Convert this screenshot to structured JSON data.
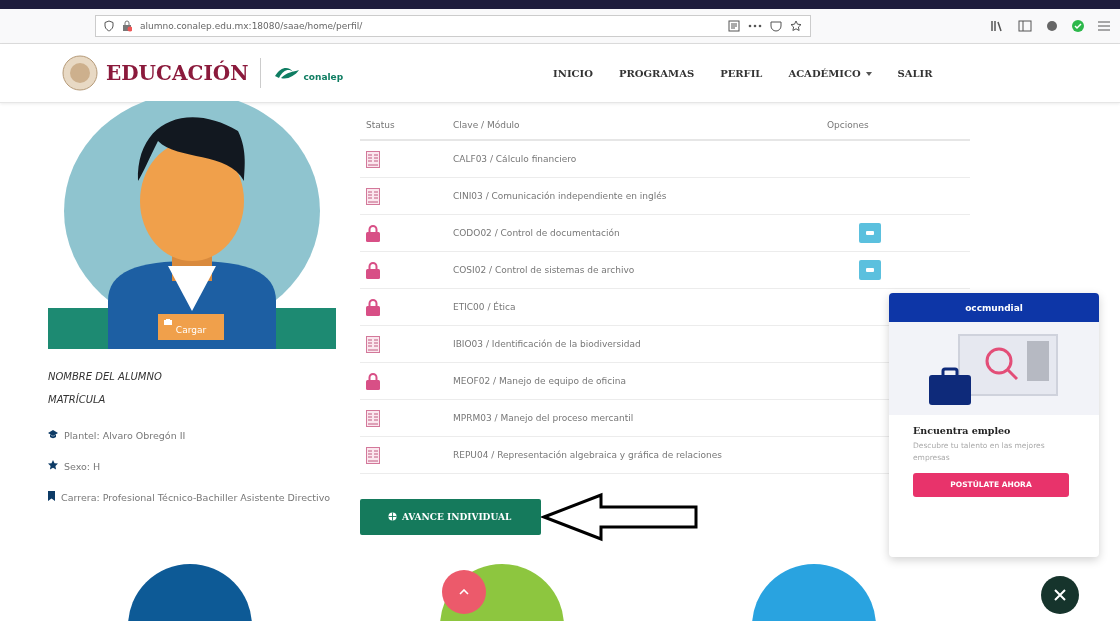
{
  "browser": {
    "url": "alumno.conalep.edu.mx:18080/saae/home/perfil/"
  },
  "header": {
    "brand": "EDUCACIÓN",
    "partner": "conalep",
    "nav": [
      {
        "label": "INICIO",
        "dropdown": false
      },
      {
        "label": "PROGRAMAS",
        "dropdown": false
      },
      {
        "label": "PERFIL",
        "dropdown": false
      },
      {
        "label": "ACADÉMICO",
        "dropdown": true
      },
      {
        "label": "SALIR",
        "dropdown": false
      }
    ]
  },
  "profile": {
    "upload_button": "Cargar",
    "name": "NOMBRE DEL ALUMNO",
    "id_label": "MATRÍCULA",
    "details": [
      {
        "kind": "school",
        "text": "Plantel: Alvaro Obregón II"
      },
      {
        "kind": "star",
        "text": "Sexo: H"
      },
      {
        "kind": "bookmark",
        "text": "Carrera: Profesional Técnico-Bachiller Asistente Directivo"
      }
    ]
  },
  "table": {
    "columns": [
      "Status",
      "Clave / Módulo",
      "Opciones"
    ],
    "rows": [
      {
        "kind": "document",
        "module": "CALF03 / Cálculo financiero",
        "option": false
      },
      {
        "kind": "document",
        "module": "CINI03 / Comunicación independiente en inglés",
        "option": false
      },
      {
        "kind": "locked",
        "module": "CODO02 / Control de documentación",
        "option": true
      },
      {
        "kind": "locked",
        "module": "COSI02 / Control de sistemas de archivo",
        "option": true
      },
      {
        "kind": "locked",
        "module": "ETIC00 / Ética",
        "option": false
      },
      {
        "kind": "document",
        "module": "IBIO03 / Identificación de la biodiversidad",
        "option": false
      },
      {
        "kind": "locked",
        "module": "MEOF02 / Manejo de equipo de oficina",
        "option": false
      },
      {
        "kind": "document",
        "module": "MPRM03 / Manejo del proceso mercantil",
        "option": false
      },
      {
        "kind": "document",
        "module": "REPU04 / Representación algebraica y gráfica de relaciones",
        "option": false
      }
    ]
  },
  "progress_button": "AVANCE INDIVIDUAL",
  "job_popup": {
    "brand": "occmundial",
    "title": "Encuentra empleo",
    "text": "Descubre tu talento en las mejores empresas",
    "button": "POSTÚLATE AHORA"
  }
}
